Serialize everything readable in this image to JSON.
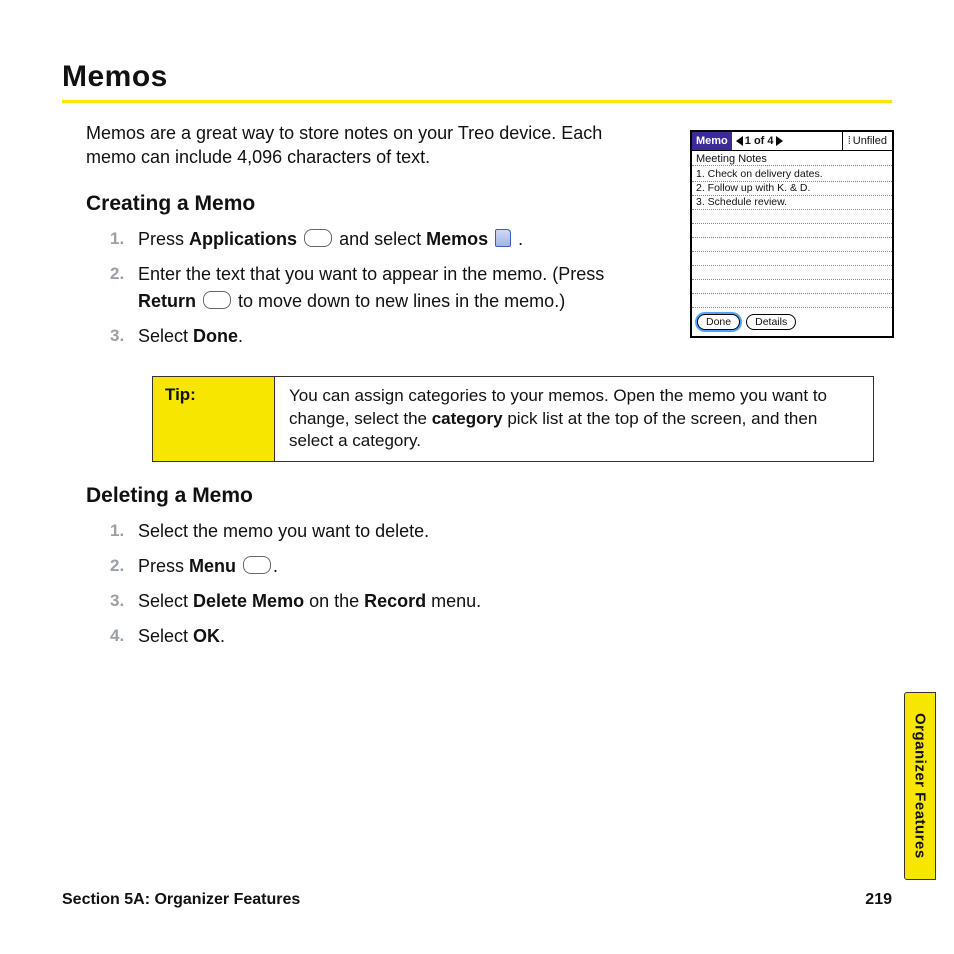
{
  "heading": "Memos",
  "intro": "Memos are a great way to store notes on your Treo device. Each memo can include 4,096 characters of text.",
  "creating": {
    "title": "Creating a Memo",
    "steps": {
      "s1a": "Press ",
      "s1b": "Applications",
      "s1c": " and select ",
      "s1d": "Memos",
      "s1e": " .",
      "s2a": "Enter the text that you want to appear in the memo. (Press ",
      "s2b": "Return",
      "s2c": " to move down to new lines in the memo.)",
      "s3a": "Select ",
      "s3b": "Done",
      "s3c": "."
    }
  },
  "tip": {
    "label": "Tip:",
    "body_a": "You can assign categories to your memos. Open the memo you want to change, select the ",
    "body_b": "category",
    "body_c": " pick list at the top of the screen, and then select a category."
  },
  "deleting": {
    "title": "Deleting a Memo",
    "steps": {
      "s1": "Select the memo you want to delete.",
      "s2a": "Press ",
      "s2b": "Menu",
      "s2c": ".",
      "s3a": "Select ",
      "s3b": "Delete Memo",
      "s3c": " on the ",
      "s3d": "Record",
      "s3e": " menu.",
      "s4a": "Select ",
      "s4b": "OK",
      "s4c": "."
    }
  },
  "screenshot": {
    "app": "Memo",
    "counter": "1 of 4",
    "category": "Unfiled",
    "memo_title": "Meeting Notes",
    "lines": [
      "1. Check on delivery dates.",
      "2. Follow up with K. & D.",
      "3. Schedule review."
    ],
    "btn_done": "Done",
    "btn_details": "Details"
  },
  "footer": {
    "section": "Section 5A: Organizer Features",
    "page": "219"
  },
  "thumb": "Organizer Features"
}
